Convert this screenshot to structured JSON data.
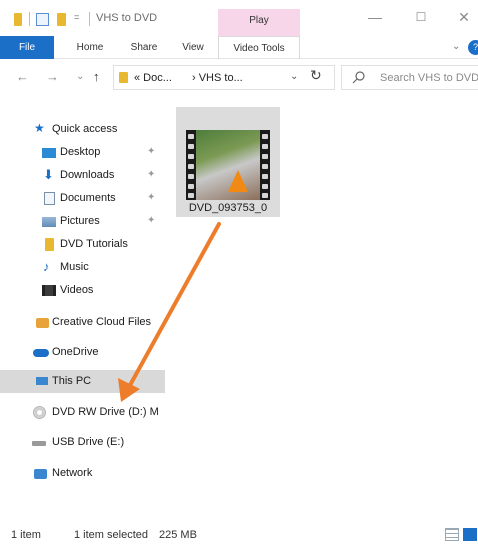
{
  "window": {
    "title": "VHS to DVD",
    "contextual_group": "Play"
  },
  "ribbon": {
    "tabs": [
      "File",
      "Home",
      "Share",
      "View",
      "Video Tools"
    ]
  },
  "address": {
    "crumbs": [
      "« Doc...",
      "› VHS to..."
    ],
    "search_placeholder": "Search VHS to DVD"
  },
  "nav": {
    "items": [
      {
        "label": "Quick access",
        "icon": "star-icon"
      },
      {
        "label": "Desktop",
        "icon": "desktop-icon",
        "pinned": true
      },
      {
        "label": "Downloads",
        "icon": "download-icon",
        "pinned": true
      },
      {
        "label": "Documents",
        "icon": "documents-icon",
        "pinned": true
      },
      {
        "label": "Pictures",
        "icon": "pictures-icon",
        "pinned": true
      },
      {
        "label": "DVD Tutorials",
        "icon": "folder-icon"
      },
      {
        "label": "Music",
        "icon": "music-icon"
      },
      {
        "label": "Videos",
        "icon": "videos-icon"
      },
      {
        "label": "Creative Cloud Files",
        "icon": "creative-cloud-icon"
      },
      {
        "label": "OneDrive",
        "icon": "cloud-icon"
      },
      {
        "label": "This PC",
        "icon": "computer-icon",
        "selected": true
      },
      {
        "label": "DVD RW Drive (D:) M",
        "icon": "disc-icon"
      },
      {
        "label": "USB Drive (E:)",
        "icon": "usb-drive-icon"
      },
      {
        "label": "Network",
        "icon": "network-icon"
      }
    ]
  },
  "files": [
    {
      "name": "DVD_093753_0",
      "icon": "video-file-icon",
      "selected": true
    }
  ],
  "status": {
    "count": "1 item",
    "selection": "1 item selected",
    "size": "225 MB"
  },
  "colors": {
    "accent": "#1b6fc7",
    "contextual_tab": "#f7d6ea",
    "annotation_arrow": "#ee7d2b",
    "selected_bg": "#d9d9d9",
    "folder": "#e8b830"
  }
}
